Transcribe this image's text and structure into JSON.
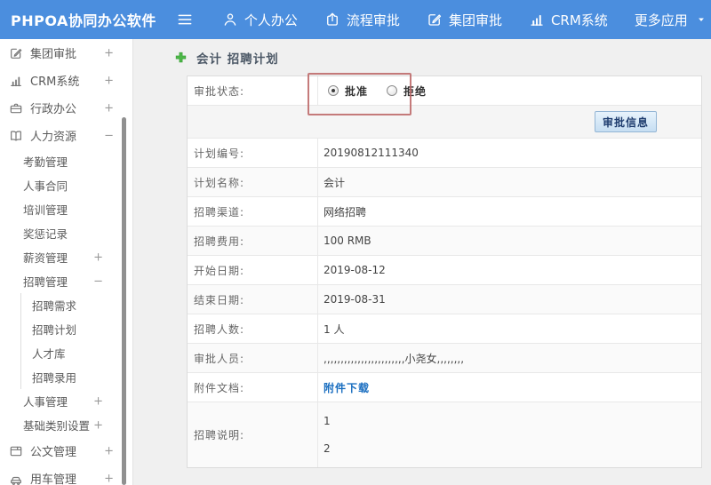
{
  "topbar": {
    "brand": "PHPOA协同办公软件",
    "nav": [
      {
        "name": "personal-office",
        "icon": "user-icon",
        "label": "个人办公"
      },
      {
        "name": "process-approval",
        "icon": "process-icon",
        "label": "流程审批"
      },
      {
        "name": "group-approval",
        "icon": "edit-icon",
        "label": "集团审批"
      },
      {
        "name": "crm-system",
        "icon": "chart-icon",
        "label": "CRM系统"
      },
      {
        "name": "more-apps",
        "icon": null,
        "label": "更多应用",
        "caret": true
      }
    ]
  },
  "sidebar": {
    "items": [
      {
        "name": "group-approval",
        "label": "集团审批",
        "icon": "edit-icon",
        "toggle": "+",
        "level": 1
      },
      {
        "name": "crm-system",
        "label": "CRM系统",
        "icon": "chart-icon",
        "toggle": "+",
        "level": 1
      },
      {
        "name": "admin-office",
        "label": "行政办公",
        "icon": "briefcase-icon",
        "toggle": "+",
        "level": 1
      },
      {
        "name": "human-resources",
        "label": "人力资源",
        "icon": "book-icon",
        "toggle": "−",
        "level": 1
      },
      {
        "name": "attendance-mgmt",
        "label": "考勤管理",
        "level": 2
      },
      {
        "name": "personnel-contract",
        "label": "人事合同",
        "level": 2
      },
      {
        "name": "training-mgmt",
        "label": "培训管理",
        "level": 2
      },
      {
        "name": "reward-punishment",
        "label": "奖惩记录",
        "level": 2
      },
      {
        "name": "salary-mgmt",
        "label": "薪资管理",
        "toggle": "+",
        "level": 2
      },
      {
        "name": "recruit-mgmt",
        "label": "招聘管理",
        "toggle": "−",
        "level": 2
      },
      {
        "name": "recruit-demand",
        "label": "招聘需求",
        "level": 3
      },
      {
        "name": "recruit-plan",
        "label": "招聘计划",
        "level": 3
      },
      {
        "name": "talent-pool",
        "label": "人才库",
        "level": 3
      },
      {
        "name": "recruit-hiring",
        "label": "招聘录用",
        "level": 3
      },
      {
        "name": "personnel-mgmt",
        "label": "人事管理",
        "toggle": "+",
        "level": 2
      },
      {
        "name": "basic-category-settings",
        "label": "基础类别设置",
        "toggle": "+",
        "level": 2
      },
      {
        "name": "document-mgmt",
        "label": "公文管理",
        "icon": "doc-icon",
        "toggle": "+",
        "level": 1
      },
      {
        "name": "vehicle-mgmt",
        "label": "用车管理",
        "icon": "car-icon",
        "toggle": "+",
        "level": 1
      }
    ]
  },
  "main": {
    "title": "会计 招聘计划",
    "approval": {
      "label": "审批状态:",
      "options": [
        {
          "name": "approve",
          "label": "批准",
          "selected": true
        },
        {
          "name": "reject",
          "label": "拒绝",
          "selected": false
        }
      ]
    },
    "approve_button": "审批信息",
    "fields": [
      {
        "name": "plan-number",
        "label": "计划编号:",
        "value": "20190812111340"
      },
      {
        "name": "plan-name",
        "label": "计划名称:",
        "value": "会计"
      },
      {
        "name": "recruit-channel",
        "label": "招聘渠道:",
        "value": "网络招聘"
      },
      {
        "name": "recruit-cost",
        "label": "招聘费用:",
        "value": "100 RMB"
      },
      {
        "name": "start-date",
        "label": "开始日期:",
        "value": "2019-08-12"
      },
      {
        "name": "end-date",
        "label": "结束日期:",
        "value": "2019-08-31"
      },
      {
        "name": "recruit-count",
        "label": "招聘人数:",
        "value": "1 人"
      },
      {
        "name": "approvers",
        "label": "审批人员:",
        "value": ",,,,,,,,,,,,,,,,,,,,,,,,小尧女,,,,,,,,"
      },
      {
        "name": "attachment",
        "label": "附件文档:",
        "value": "附件下载",
        "type": "link"
      },
      {
        "name": "recruit-description",
        "label": "招聘说明:",
        "lines": [
          "1",
          "2"
        ],
        "type": "multiline"
      }
    ]
  },
  "colors": {
    "topbar_bg": "#4b8ede",
    "link_blue": "#1a6ec0",
    "annotation_red": "#bb6464",
    "button_text": "#1e3c6e",
    "button_bg": "#cfe3f5",
    "add_icon_green": "#4db848"
  }
}
